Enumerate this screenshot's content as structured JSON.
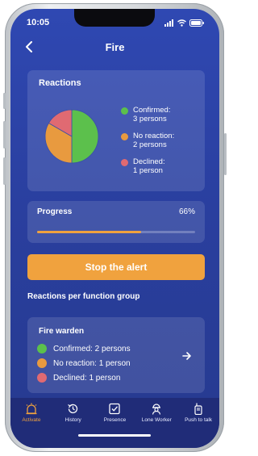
{
  "status_bar": {
    "time": "10:05"
  },
  "nav": {
    "title": "Fire"
  },
  "reactions": {
    "title": "Reactions",
    "chart_data": {
      "type": "pie",
      "slices": [
        {
          "label": "Confirmed",
          "value": 3,
          "color": "#5cc04c"
        },
        {
          "label": "No reaction",
          "value": 2,
          "color": "#e89a3f"
        },
        {
          "label": "Declined",
          "value": 1,
          "color": "#e06a72"
        }
      ]
    },
    "legend": [
      {
        "line1": "Confirmed:",
        "line2": "3 persons",
        "color": "#5cc04c"
      },
      {
        "line1": "No reaction:",
        "line2": "2 persons",
        "color": "#e89a3f"
      },
      {
        "line1": "Declined:",
        "line2": "1 person",
        "color": "#e06a72"
      }
    ]
  },
  "progress": {
    "label": "Progress",
    "value_text": "66%",
    "value": 0.66
  },
  "stop_alert": {
    "label": "Stop the alert"
  },
  "function_groups": {
    "title": "Reactions per function group",
    "group": {
      "name": "Fire warden",
      "items": [
        {
          "text": "Confirmed: 2 persons",
          "color": "#5cc04c"
        },
        {
          "text": "No reaction: 1 person",
          "color": "#e89a3f"
        },
        {
          "text": "Declined: 1 person",
          "color": "#e06a72"
        }
      ]
    }
  },
  "tabs": [
    {
      "label": "Activate",
      "icon": "alarm-bell-icon",
      "active": true
    },
    {
      "label": "History",
      "icon": "history-icon",
      "active": false
    },
    {
      "label": "Presence",
      "icon": "checkbox-icon",
      "active": false
    },
    {
      "label": "Lone Worker",
      "icon": "lone-worker-icon",
      "active": false
    },
    {
      "label": "Push to talk",
      "icon": "walkie-talkie-icon",
      "active": false
    }
  ],
  "colors": {
    "accent": "#f0a23e",
    "background": "#2a3f9f",
    "tabbar": "#202c78"
  }
}
